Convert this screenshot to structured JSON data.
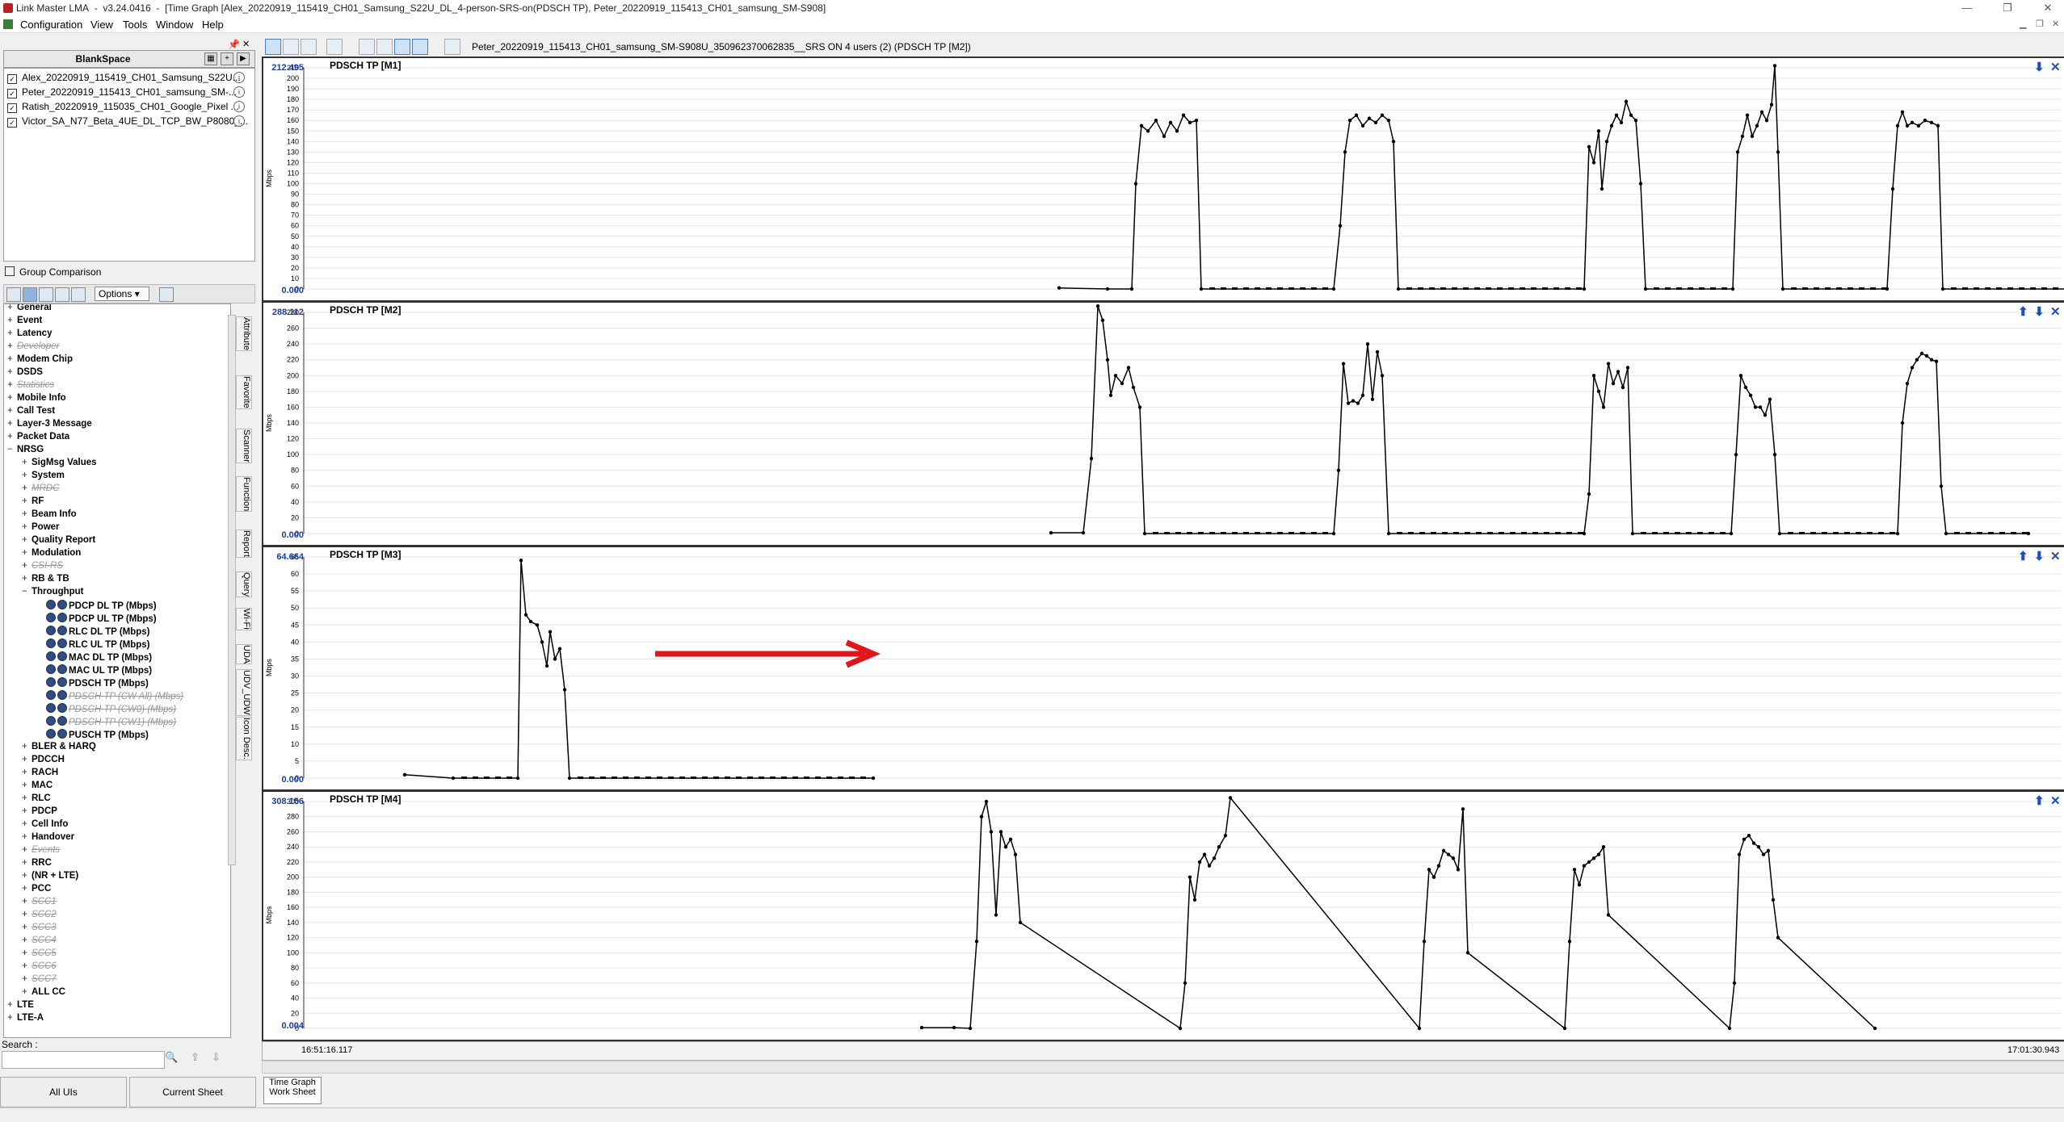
{
  "window": {
    "app_name": "Link Master LMA",
    "version": "v3.24.0416",
    "title_detail": "[Time Graph [Alex_20220919_115419_CH01_Samsung_S22U_DL_4-person-SRS-on(PDSCH TP), Peter_20220919_115413_CH01_samsung_SM-S908]",
    "minimize": "—",
    "restore": "❐",
    "close": "✕"
  },
  "menu": [
    "Configuration",
    "View",
    "Tools",
    "Window",
    "Help"
  ],
  "workspace": {
    "title": "BlankSpace",
    "logfiles": [
      "Alex_20220919_115419_CH01_Samsung_S22U...",
      "Peter_20220919_115413_CH01_samsung_SM-...",
      "Ratish_20220919_115035_CH01_Google_Pixel ...",
      "Victor_SA_N77_Beta_4UE_DL_TCP_BW_P8080_..."
    ],
    "group_comparison": "Group Comparison",
    "options_label": "Options"
  },
  "tree": [
    {
      "pm": "+",
      "label": "General",
      "level": 0,
      "dis": false
    },
    {
      "pm": "+",
      "label": "Event",
      "level": 0,
      "dis": false
    },
    {
      "pm": "+",
      "label": "Latency",
      "level": 0,
      "dis": false
    },
    {
      "pm": "+",
      "label": "Developer",
      "level": 0,
      "dis": true
    },
    {
      "pm": "+",
      "label": "Modem Chip",
      "level": 0,
      "dis": false
    },
    {
      "pm": "+",
      "label": "DSDS",
      "level": 0,
      "dis": false
    },
    {
      "pm": "+",
      "label": "Statistics",
      "level": 0,
      "dis": true
    },
    {
      "pm": "+",
      "label": "Mobile Info",
      "level": 0,
      "dis": false
    },
    {
      "pm": "+",
      "label": "Call Test",
      "level": 0,
      "dis": false
    },
    {
      "pm": "+",
      "label": "Layer-3 Message",
      "level": 0,
      "dis": false
    },
    {
      "pm": "+",
      "label": "Packet Data",
      "level": 0,
      "dis": false
    },
    {
      "pm": "−",
      "label": "NRSG",
      "level": 0,
      "dis": false
    },
    {
      "pm": "+",
      "label": "SigMsg Values",
      "level": 1,
      "dis": false
    },
    {
      "pm": "+",
      "label": "System",
      "level": 1,
      "dis": false
    },
    {
      "pm": "+",
      "label": "MRDC",
      "level": 1,
      "dis": true
    },
    {
      "pm": "+",
      "label": "RF",
      "level": 1,
      "dis": false
    },
    {
      "pm": "+",
      "label": "Beam Info",
      "level": 1,
      "dis": false
    },
    {
      "pm": "+",
      "label": "Power",
      "level": 1,
      "dis": false
    },
    {
      "pm": "+",
      "label": "Quality Report",
      "level": 1,
      "dis": false
    },
    {
      "pm": "+",
      "label": "Modulation",
      "level": 1,
      "dis": false
    },
    {
      "pm": "+",
      "label": "CSI-RS",
      "level": 1,
      "dis": true
    },
    {
      "pm": "+",
      "label": "RB & TB",
      "level": 1,
      "dis": false
    },
    {
      "pm": "−",
      "label": "Throughput",
      "level": 1,
      "dis": false
    },
    {
      "pm": "",
      "label": "PDCP DL TP (Mbps)",
      "level": 2,
      "dis": false
    },
    {
      "pm": "",
      "label": "PDCP UL TP (Mbps)",
      "level": 2,
      "dis": false
    },
    {
      "pm": "",
      "label": "RLC DL TP (Mbps)",
      "level": 2,
      "dis": false
    },
    {
      "pm": "",
      "label": "RLC UL TP (Mbps)",
      "level": 2,
      "dis": false
    },
    {
      "pm": "",
      "label": "MAC DL TP (Mbps)",
      "level": 2,
      "dis": false
    },
    {
      "pm": "",
      "label": "MAC UL TP (Mbps)",
      "level": 2,
      "dis": false
    },
    {
      "pm": "",
      "label": "PDSCH TP (Mbps)",
      "level": 2,
      "dis": false
    },
    {
      "pm": "",
      "label": "PDSCH TP (CW All) (Mbps)",
      "level": 2,
      "dis": true
    },
    {
      "pm": "",
      "label": "PDSCH TP (CW0) (Mbps)",
      "level": 2,
      "dis": true
    },
    {
      "pm": "",
      "label": "PDSCH TP (CW1) (Mbps)",
      "level": 2,
      "dis": true
    },
    {
      "pm": "",
      "label": "PUSCH TP (Mbps)",
      "level": 2,
      "dis": false
    },
    {
      "pm": "+",
      "label": "BLER & HARQ",
      "level": 1,
      "dis": false
    },
    {
      "pm": "+",
      "label": "PDCCH",
      "level": 1,
      "dis": false
    },
    {
      "pm": "+",
      "label": "RACH",
      "level": 1,
      "dis": false
    },
    {
      "pm": "+",
      "label": "MAC",
      "level": 1,
      "dis": false
    },
    {
      "pm": "+",
      "label": "RLC",
      "level": 1,
      "dis": false
    },
    {
      "pm": "+",
      "label": "PDCP",
      "level": 1,
      "dis": false
    },
    {
      "pm": "+",
      "label": "Cell Info",
      "level": 1,
      "dis": false
    },
    {
      "pm": "+",
      "label": "Handover",
      "level": 1,
      "dis": false
    },
    {
      "pm": "+",
      "label": "Events",
      "level": 1,
      "dis": true
    },
    {
      "pm": "+",
      "label": "RRC",
      "level": 1,
      "dis": false
    },
    {
      "pm": "+",
      "label": "(NR + LTE)",
      "level": 1,
      "dis": false
    },
    {
      "pm": "+",
      "label": "PCC",
      "level": 1,
      "dis": false
    },
    {
      "pm": "+",
      "label": "SCC1",
      "level": 1,
      "dis": true
    },
    {
      "pm": "+",
      "label": "SCC2",
      "level": 1,
      "dis": true
    },
    {
      "pm": "+",
      "label": "SCC3",
      "level": 1,
      "dis": true
    },
    {
      "pm": "+",
      "label": "SCC4",
      "level": 1,
      "dis": true
    },
    {
      "pm": "+",
      "label": "SCC5",
      "level": 1,
      "dis": true
    },
    {
      "pm": "+",
      "label": "SCC6",
      "level": 1,
      "dis": true
    },
    {
      "pm": "+",
      "label": "SCC7",
      "level": 1,
      "dis": true
    },
    {
      "pm": "+",
      "label": "ALL CC",
      "level": 1,
      "dis": false
    },
    {
      "pm": "+",
      "label": "LTE",
      "level": 0,
      "dis": false
    },
    {
      "pm": "+",
      "label": "LTE-A",
      "level": 0,
      "dis": false
    }
  ],
  "vtabs": [
    "Attribute",
    "Favorite",
    "Scanner",
    "Function",
    "Report",
    "Query",
    "Wi-Fi",
    "UDA",
    "UDV_UDW",
    "Icon Desc."
  ],
  "search_label": "Search :",
  "bottom_tabs": [
    "All UIs",
    "Current Sheet"
  ],
  "graph_title": "Peter_20220919_115413_CH01_samsung_SM-S908U_350962370062835__SRS ON 4 users (2) (PDSCH TP [M2])",
  "y_unit": "Mbps",
  "panels": [
    {
      "title": "PDSCH TP [M1]",
      "ymax_label": "212.495",
      "ymin_label": "0.000",
      "ymax": 210,
      "step": 10,
      "controls": [
        "⬇",
        "✕"
      ]
    },
    {
      "title": "PDSCH TP [M2]",
      "ymax_label": "288.112",
      "ymin_label": "0.000",
      "ymax": 280,
      "step": 20,
      "controls": [
        "⬆",
        "⬇",
        "✕"
      ]
    },
    {
      "title": "PDSCH TP [M3]",
      "ymax_label": "64.664",
      "ymin_label": "0.000",
      "ymax": 65,
      "step": 5,
      "controls": [
        "⬆",
        "⬇",
        "✕"
      ]
    },
    {
      "title": "PDSCH TP [M4]",
      "ymax_label": "308.156",
      "ymin_label": "0.004",
      "ymax": 300,
      "step": 20,
      "controls": [
        "⬆",
        "✕"
      ]
    }
  ],
  "time_start": "16:51:16.117",
  "time_end": "17:01:30.943",
  "sheet_tab": "Time Graph Work Sheet",
  "accent": "#e0161c"
}
